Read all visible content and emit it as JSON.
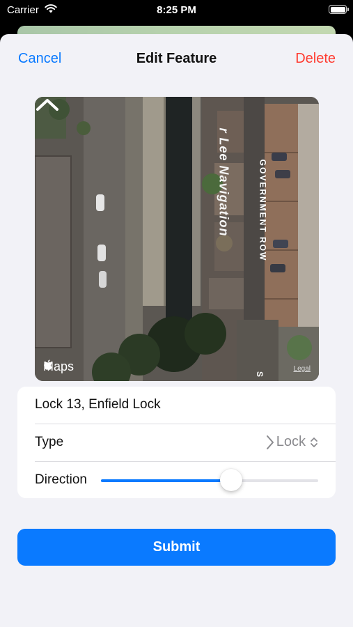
{
  "status_bar": {
    "carrier": "Carrier",
    "time": "8:25 PM",
    "battery_level": 1.0
  },
  "nav": {
    "cancel_label": "Cancel",
    "title": "Edit Feature",
    "delete_label": "Delete"
  },
  "map": {
    "river_label": "r Lee Navigation",
    "road_label": "GOVERNMENT ROW",
    "edge_label": "S",
    "brand": "Maps",
    "legal": "Legal"
  },
  "form": {
    "name_value": "Lock 13, Enfield Lock",
    "type_label": "Type",
    "type_value": "Lock",
    "direction_label": "Direction",
    "direction_fraction": 0.6
  },
  "submit_label": "Submit",
  "colors": {
    "accent": "#0a7aff",
    "destructive": "#ff3b30",
    "background": "#f2f2f7"
  },
  "icons": [
    "wifi-icon",
    "battery-icon",
    "chevron-up-icon",
    "apple-logo-icon",
    "chevron-right-icon",
    "chevron-up-down-icon"
  ]
}
